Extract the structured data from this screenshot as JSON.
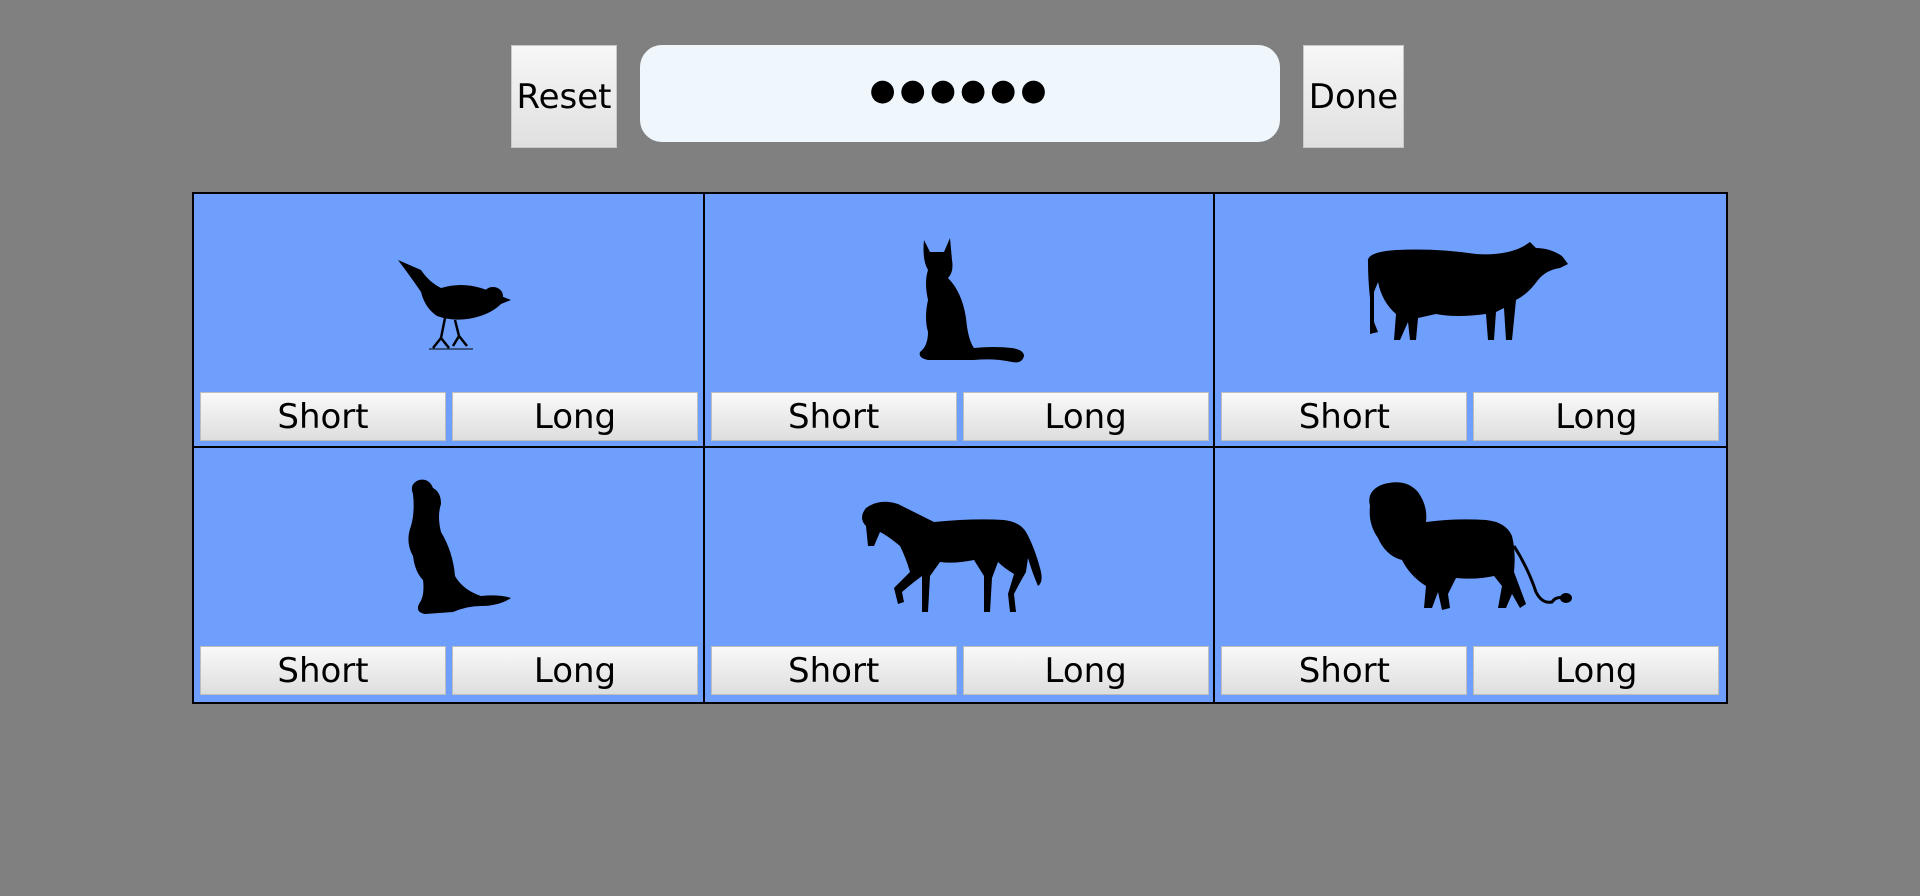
{
  "toolbar": {
    "reset_label": "Reset",
    "done_label": "Done",
    "password_value": "●●●●●●"
  },
  "animals": [
    {
      "icon": "bird-icon",
      "short_label": "Short",
      "long_label": "Long"
    },
    {
      "icon": "cat-icon",
      "short_label": "Short",
      "long_label": "Long"
    },
    {
      "icon": "cow-icon",
      "short_label": "Short",
      "long_label": "Long"
    },
    {
      "icon": "dog-icon",
      "short_label": "Short",
      "long_label": "Long"
    },
    {
      "icon": "horse-icon",
      "short_label": "Short",
      "long_label": "Long"
    },
    {
      "icon": "lion-icon",
      "short_label": "Short",
      "long_label": "Long"
    }
  ],
  "colors": {
    "background": "#808080",
    "cell_background": "#6f9ffd",
    "field_background": "#eff7fd"
  }
}
